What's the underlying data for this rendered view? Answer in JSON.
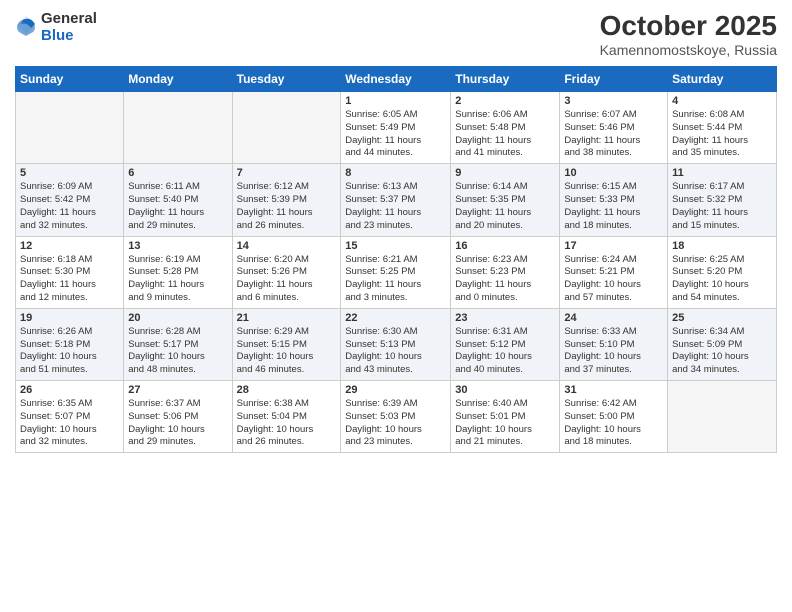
{
  "header": {
    "logo_general": "General",
    "logo_blue": "Blue",
    "title": "October 2025",
    "subtitle": "Kamennomostskoye, Russia"
  },
  "weekdays": [
    "Sunday",
    "Monday",
    "Tuesday",
    "Wednesday",
    "Thursday",
    "Friday",
    "Saturday"
  ],
  "weeks": [
    {
      "alt": false,
      "days": [
        {
          "num": "",
          "info": "",
          "empty": true
        },
        {
          "num": "",
          "info": "",
          "empty": true
        },
        {
          "num": "",
          "info": "",
          "empty": true
        },
        {
          "num": "1",
          "info": "Sunrise: 6:05 AM\nSunset: 5:49 PM\nDaylight: 11 hours\nand 44 minutes.",
          "empty": false
        },
        {
          "num": "2",
          "info": "Sunrise: 6:06 AM\nSunset: 5:48 PM\nDaylight: 11 hours\nand 41 minutes.",
          "empty": false
        },
        {
          "num": "3",
          "info": "Sunrise: 6:07 AM\nSunset: 5:46 PM\nDaylight: 11 hours\nand 38 minutes.",
          "empty": false
        },
        {
          "num": "4",
          "info": "Sunrise: 6:08 AM\nSunset: 5:44 PM\nDaylight: 11 hours\nand 35 minutes.",
          "empty": false
        }
      ]
    },
    {
      "alt": true,
      "days": [
        {
          "num": "5",
          "info": "Sunrise: 6:09 AM\nSunset: 5:42 PM\nDaylight: 11 hours\nand 32 minutes.",
          "empty": false
        },
        {
          "num": "6",
          "info": "Sunrise: 6:11 AM\nSunset: 5:40 PM\nDaylight: 11 hours\nand 29 minutes.",
          "empty": false
        },
        {
          "num": "7",
          "info": "Sunrise: 6:12 AM\nSunset: 5:39 PM\nDaylight: 11 hours\nand 26 minutes.",
          "empty": false
        },
        {
          "num": "8",
          "info": "Sunrise: 6:13 AM\nSunset: 5:37 PM\nDaylight: 11 hours\nand 23 minutes.",
          "empty": false
        },
        {
          "num": "9",
          "info": "Sunrise: 6:14 AM\nSunset: 5:35 PM\nDaylight: 11 hours\nand 20 minutes.",
          "empty": false
        },
        {
          "num": "10",
          "info": "Sunrise: 6:15 AM\nSunset: 5:33 PM\nDaylight: 11 hours\nand 18 minutes.",
          "empty": false
        },
        {
          "num": "11",
          "info": "Sunrise: 6:17 AM\nSunset: 5:32 PM\nDaylight: 11 hours\nand 15 minutes.",
          "empty": false
        }
      ]
    },
    {
      "alt": false,
      "days": [
        {
          "num": "12",
          "info": "Sunrise: 6:18 AM\nSunset: 5:30 PM\nDaylight: 11 hours\nand 12 minutes.",
          "empty": false
        },
        {
          "num": "13",
          "info": "Sunrise: 6:19 AM\nSunset: 5:28 PM\nDaylight: 11 hours\nand 9 minutes.",
          "empty": false
        },
        {
          "num": "14",
          "info": "Sunrise: 6:20 AM\nSunset: 5:26 PM\nDaylight: 11 hours\nand 6 minutes.",
          "empty": false
        },
        {
          "num": "15",
          "info": "Sunrise: 6:21 AM\nSunset: 5:25 PM\nDaylight: 11 hours\nand 3 minutes.",
          "empty": false
        },
        {
          "num": "16",
          "info": "Sunrise: 6:23 AM\nSunset: 5:23 PM\nDaylight: 11 hours\nand 0 minutes.",
          "empty": false
        },
        {
          "num": "17",
          "info": "Sunrise: 6:24 AM\nSunset: 5:21 PM\nDaylight: 10 hours\nand 57 minutes.",
          "empty": false
        },
        {
          "num": "18",
          "info": "Sunrise: 6:25 AM\nSunset: 5:20 PM\nDaylight: 10 hours\nand 54 minutes.",
          "empty": false
        }
      ]
    },
    {
      "alt": true,
      "days": [
        {
          "num": "19",
          "info": "Sunrise: 6:26 AM\nSunset: 5:18 PM\nDaylight: 10 hours\nand 51 minutes.",
          "empty": false
        },
        {
          "num": "20",
          "info": "Sunrise: 6:28 AM\nSunset: 5:17 PM\nDaylight: 10 hours\nand 48 minutes.",
          "empty": false
        },
        {
          "num": "21",
          "info": "Sunrise: 6:29 AM\nSunset: 5:15 PM\nDaylight: 10 hours\nand 46 minutes.",
          "empty": false
        },
        {
          "num": "22",
          "info": "Sunrise: 6:30 AM\nSunset: 5:13 PM\nDaylight: 10 hours\nand 43 minutes.",
          "empty": false
        },
        {
          "num": "23",
          "info": "Sunrise: 6:31 AM\nSunset: 5:12 PM\nDaylight: 10 hours\nand 40 minutes.",
          "empty": false
        },
        {
          "num": "24",
          "info": "Sunrise: 6:33 AM\nSunset: 5:10 PM\nDaylight: 10 hours\nand 37 minutes.",
          "empty": false
        },
        {
          "num": "25",
          "info": "Sunrise: 6:34 AM\nSunset: 5:09 PM\nDaylight: 10 hours\nand 34 minutes.",
          "empty": false
        }
      ]
    },
    {
      "alt": false,
      "days": [
        {
          "num": "26",
          "info": "Sunrise: 6:35 AM\nSunset: 5:07 PM\nDaylight: 10 hours\nand 32 minutes.",
          "empty": false
        },
        {
          "num": "27",
          "info": "Sunrise: 6:37 AM\nSunset: 5:06 PM\nDaylight: 10 hours\nand 29 minutes.",
          "empty": false
        },
        {
          "num": "28",
          "info": "Sunrise: 6:38 AM\nSunset: 5:04 PM\nDaylight: 10 hours\nand 26 minutes.",
          "empty": false
        },
        {
          "num": "29",
          "info": "Sunrise: 6:39 AM\nSunset: 5:03 PM\nDaylight: 10 hours\nand 23 minutes.",
          "empty": false
        },
        {
          "num": "30",
          "info": "Sunrise: 6:40 AM\nSunset: 5:01 PM\nDaylight: 10 hours\nand 21 minutes.",
          "empty": false
        },
        {
          "num": "31",
          "info": "Sunrise: 6:42 AM\nSunset: 5:00 PM\nDaylight: 10 hours\nand 18 minutes.",
          "empty": false
        },
        {
          "num": "",
          "info": "",
          "empty": true
        }
      ]
    }
  ]
}
